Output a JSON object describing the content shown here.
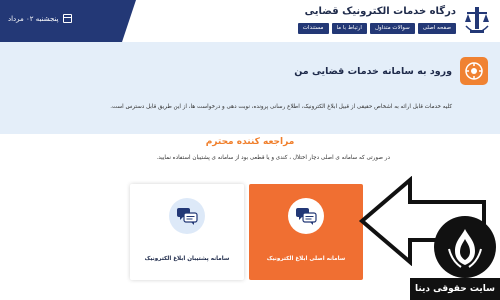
{
  "header": {
    "title": "درگاه خدمات الکترونیک قضایی",
    "date": "پنجشنبه ۰۲ مرداد",
    "nav": [
      "صفحه اصلی",
      "سوالات متداول",
      "ارتباط با ما",
      "مستندات"
    ]
  },
  "banner": {
    "title": "ورود به سامانه خدمات قضایی من",
    "text": "کلیه خدمات قابل ارائه به اشخاص حقیقی از قبیل ابلاغ الکترونیک، اطلاع رسانی پرونده، نوبت دهی و درخواست ها، از این طریق قابل دسترس است."
  },
  "main": {
    "title": "مراجعه کننده محترم",
    "description": "در صورتی که سامانه ی اصلی دچار اختلال ، کندی و یا قطعی بود از سامانه ی پشتیبان استفاده نمایید.",
    "cards": {
      "main_label": "سامانه اصلی ابلاغ الکترونیک",
      "support_label": "سامانه پشتیبان ابلاغ الکترونیک"
    }
  },
  "watermark": {
    "site_name": "سایت حقوقی دینا"
  },
  "colors": {
    "navy": "#233876",
    "orange": "#f06f32",
    "banner_bg": "#e4eef9"
  },
  "icons": [
    "calendar-icon",
    "judiciary-emblem-icon",
    "info-service-icon",
    "chat-bubbles-icon"
  ]
}
